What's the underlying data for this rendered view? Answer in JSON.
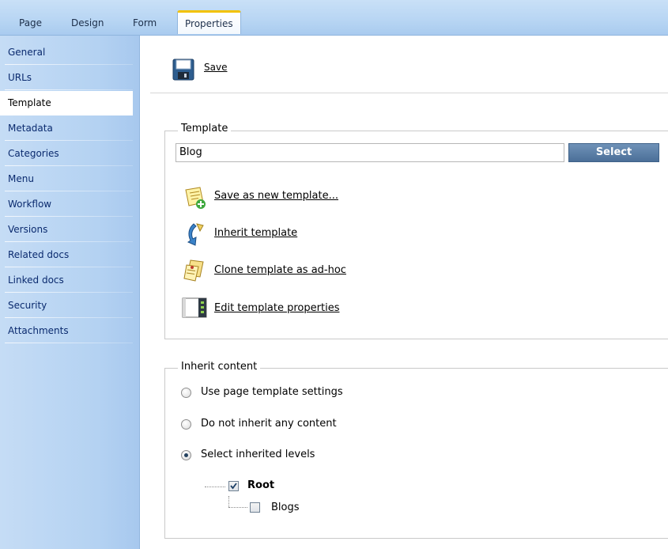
{
  "tabs": [
    {
      "label": "Page"
    },
    {
      "label": "Design"
    },
    {
      "label": "Form"
    },
    {
      "label": "Properties"
    }
  ],
  "active_tab": "Properties",
  "sidebar": {
    "items": [
      {
        "label": "General"
      },
      {
        "label": "URLs"
      },
      {
        "label": "Template"
      },
      {
        "label": "Metadata"
      },
      {
        "label": "Categories"
      },
      {
        "label": "Menu"
      },
      {
        "label": "Workflow"
      },
      {
        "label": "Versions"
      },
      {
        "label": "Related docs"
      },
      {
        "label": "Linked docs"
      },
      {
        "label": "Security"
      },
      {
        "label": "Attachments"
      }
    ],
    "active": "Template"
  },
  "toolbar": {
    "save_label": "Save",
    "save_icon": "floppy-disk-icon"
  },
  "template_section": {
    "legend": "Template",
    "value": "Blog",
    "select_label": "Select",
    "actions": [
      {
        "label": "Save as new template...",
        "icon": "save-as-new-template-icon"
      },
      {
        "label": "Inherit template",
        "icon": "inherit-template-icon"
      },
      {
        "label": "Clone template as ad-hoc",
        "icon": "clone-template-icon"
      },
      {
        "label": "Edit template properties",
        "icon": "edit-template-properties-icon"
      }
    ]
  },
  "inherit_section": {
    "legend": "Inherit content",
    "options": [
      {
        "label": "Use page template settings",
        "selected": false
      },
      {
        "label": "Do not inherit any content",
        "selected": false
      },
      {
        "label": "Select inherited levels",
        "selected": true
      }
    ],
    "tree": [
      {
        "label": "Root",
        "checked": true,
        "bold": true
      },
      {
        "label": "Blogs",
        "checked": false,
        "bold": false
      }
    ]
  },
  "colors": {
    "select_button": "#4f7399",
    "tab_accent": "#f2c200",
    "sidebar_text": "#0a2a6e"
  }
}
